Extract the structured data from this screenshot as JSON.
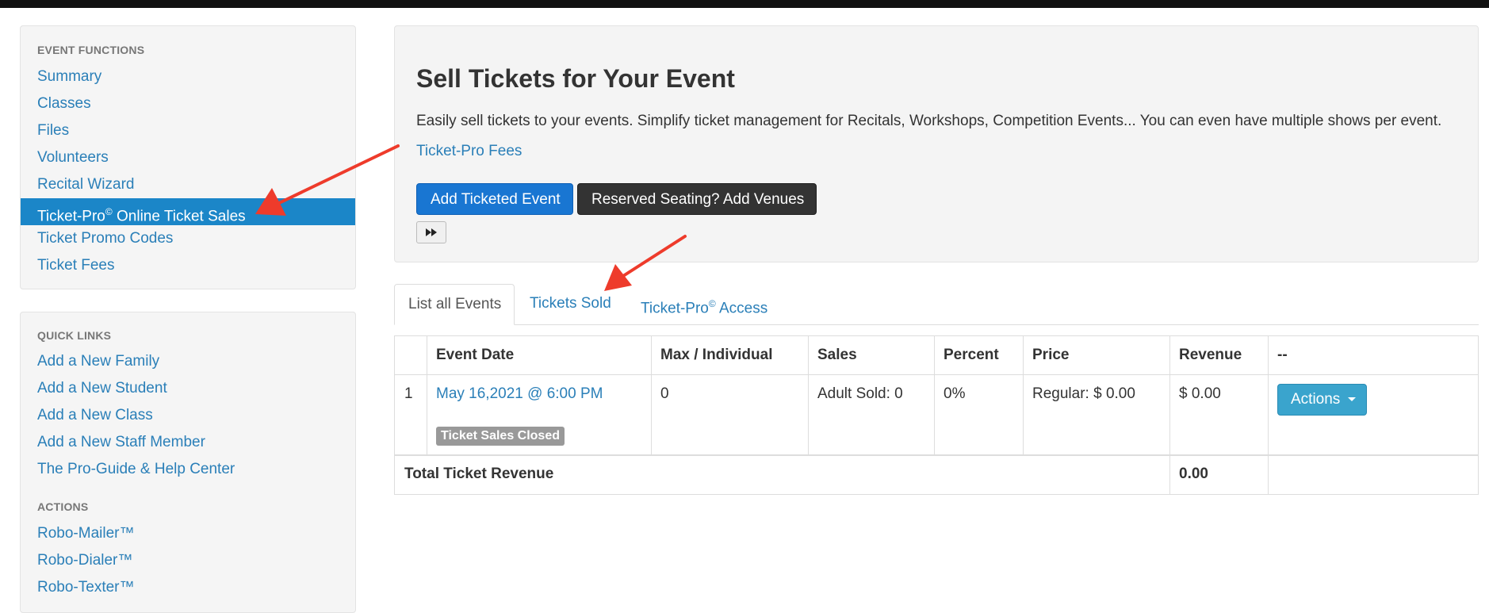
{
  "sidebar": {
    "functions": {
      "heading": "EVENT FUNCTIONS",
      "items": [
        {
          "label": "Summary"
        },
        {
          "label": "Classes"
        },
        {
          "label": "Files"
        },
        {
          "label": "Volunteers"
        },
        {
          "label": "Recital Wizard"
        },
        {
          "label": "Ticket-Pro",
          "sup": "©",
          "suffix": " Online Ticket Sales"
        },
        {
          "label": "Ticket Promo Codes"
        },
        {
          "label": "Ticket Fees"
        }
      ]
    },
    "quick_links": {
      "heading": "QUICK LINKS",
      "items": [
        {
          "label": "Add a New Family"
        },
        {
          "label": "Add a New Student"
        },
        {
          "label": "Add a New Class"
        },
        {
          "label": "Add a New Staff Member"
        },
        {
          "label": "The Pro-Guide & Help Center"
        }
      ]
    },
    "actions": {
      "heading": "ACTIONS",
      "items": [
        {
          "label": "Robo-Mailer™"
        },
        {
          "label": "Robo-Dialer™"
        },
        {
          "label": "Robo-Texter™"
        }
      ]
    }
  },
  "hero": {
    "title": "Sell Tickets for Your Event",
    "description": "Easily sell tickets to your events. Simplify ticket management for Recitals, Workshops, Competition Events... You can even have multiple shows per event.",
    "fees_link": "Ticket-Pro Fees",
    "add_button": "Add Ticketed Event",
    "venues_button": "Reserved Seating? Add Venues",
    "forward_icon": "fast-forward-icon"
  },
  "tabs": {
    "list": "List all Events",
    "sold": "Tickets Sold",
    "access_prefix": "Ticket-Pro",
    "access_sup": "©",
    "access_suffix": " Access"
  },
  "table": {
    "headers": [
      "",
      "Event Date",
      "Max / Individual",
      "Sales",
      "Percent",
      "Price",
      "Revenue",
      "--"
    ],
    "rows": [
      {
        "num": "1",
        "event_date": "May 16,2021 @ 6:00 PM",
        "status_badge": "Ticket Sales Closed",
        "max_individual": "0",
        "sales": "Adult Sold: 0",
        "percent": "0%",
        "price": "Regular: $ 0.00",
        "revenue": "$ 0.00",
        "actions_label": "Actions"
      }
    ],
    "total_label": "Total Ticket Revenue",
    "total_value": "0.00"
  },
  "colors": {
    "link": "#2a7fb8",
    "active_nav": "#1b86c8",
    "primary_button": "#1976d2",
    "dark_button": "#333333",
    "actions_button": "#3aa4cd",
    "badge": "#999999",
    "annotation_arrow": "#ee3b2b"
  }
}
